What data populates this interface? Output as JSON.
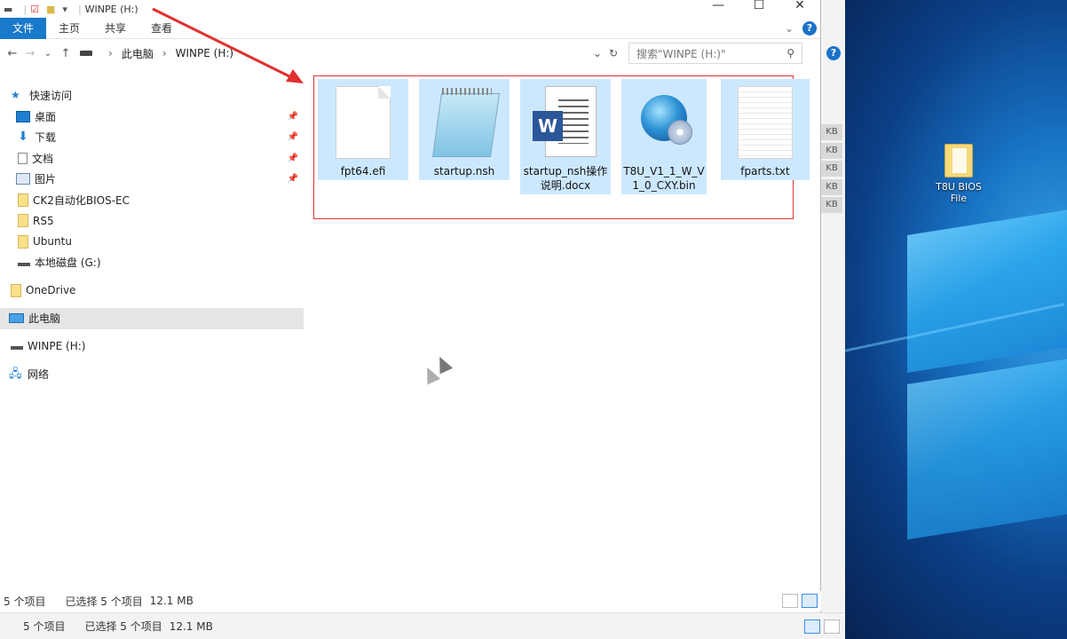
{
  "window": {
    "title": "WINPE (H:)",
    "controls": {
      "minimize": "—",
      "maximize": "☐",
      "close": "✕"
    }
  },
  "ribbon": {
    "tabs": [
      "文件",
      "主页",
      "共享",
      "查看"
    ],
    "active_tab": "文件",
    "help": "?"
  },
  "address": {
    "path": [
      "此电脑",
      "WINPE (H:)"
    ],
    "search_placeholder": "搜索\"WINPE (H:)\""
  },
  "sidebar": {
    "quick_access": "快速访问",
    "pinned": [
      {
        "label": "桌面",
        "icon": "desktop-icon"
      },
      {
        "label": "下载",
        "icon": "download-icon"
      },
      {
        "label": "文档",
        "icon": "document-icon"
      },
      {
        "label": "图片",
        "icon": "pictures-icon"
      }
    ],
    "folders": [
      "CK2自动化BIOS-EC",
      "RS5",
      "Ubuntu"
    ],
    "local_disk": "本地磁盘 (G:)",
    "onedrive": "OneDrive",
    "this_pc": "此电脑",
    "winpe": "WINPE (H:)",
    "network": "网络"
  },
  "files": [
    {
      "name": "fpt64.efi",
      "icon": "blank-file-icon"
    },
    {
      "name": "startup.nsh",
      "icon": "notepad-icon"
    },
    {
      "name": "startup_nsh操作说明.docx",
      "icon": "word-document-icon"
    },
    {
      "name": "T8U_V1_1_W_V1_0_CXY.bin",
      "icon": "disc-globe-icon"
    },
    {
      "name": "fparts.txt",
      "icon": "text-file-icon"
    }
  ],
  "status": {
    "item_count": "5 个项目",
    "selected": "已选择 5 个项目",
    "size": "12.1 MB"
  },
  "status_back": {
    "item_count": "5 个项目",
    "selected": "已选择 5 个项目",
    "size": "12.1 MB"
  },
  "back_window": {
    "size_badges": [
      "KB",
      "KB",
      "KB",
      "KB",
      "KB"
    ],
    "help": "?"
  },
  "desktop": {
    "icon_label_line1": "T8U BIOS",
    "icon_label_line2": "File"
  },
  "colors": {
    "accent": "#1979ca",
    "selection": "#cce8ff",
    "highlight_box": "#dd3333"
  }
}
